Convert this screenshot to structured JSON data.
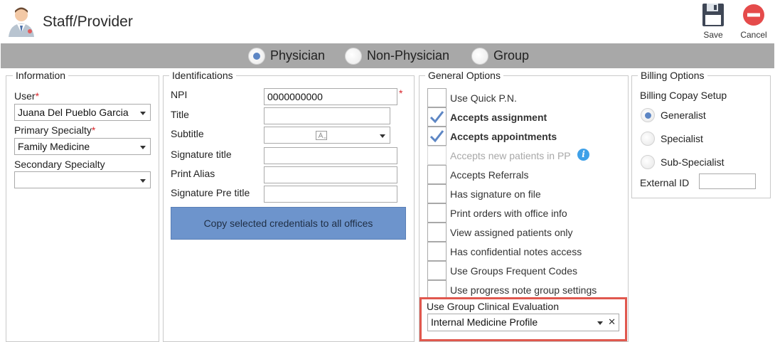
{
  "header": {
    "title": "Staff/Provider",
    "save_label": "Save",
    "cancel_label": "Cancel"
  },
  "tabs": [
    {
      "label": "Physician",
      "selected": true
    },
    {
      "label": "Non-Physician",
      "selected": false
    },
    {
      "label": "Group",
      "selected": false
    }
  ],
  "information": {
    "title": "Information",
    "user_label": "User",
    "user_value": "Juana Del Pueblo Garcia",
    "primary_specialty_label": "Primary Specialty",
    "primary_specialty_value": "Family Medicine",
    "secondary_specialty_label": "Secondary Specialty",
    "secondary_specialty_value": "",
    "required_mark": "*"
  },
  "identifications": {
    "title": "Identifications",
    "npi_label": "NPI",
    "npi_value": "0000000000",
    "title_label": "Title",
    "title_value": "",
    "subtitle_label": "Subtitle",
    "subtitle_value": "",
    "signature_title_label": "Signature title",
    "signature_title_value": "",
    "print_alias_label": "Print Alias",
    "print_alias_value": "",
    "signature_pre_title_label": "Signature Pre title",
    "signature_pre_title_value": "",
    "copy_button_label": "Copy selected credentials to all offices",
    "required_mark": "*"
  },
  "general_options": {
    "title": "General Options",
    "items": [
      {
        "label": "Use Quick P.N.",
        "checked": false,
        "bold": false,
        "disabled": false
      },
      {
        "label": "Accepts assignment",
        "checked": true,
        "bold": true,
        "disabled": false
      },
      {
        "label": "Accepts appointments",
        "checked": true,
        "bold": true,
        "disabled": false
      },
      {
        "label": "Accepts new patients in PP",
        "checked": false,
        "bold": false,
        "disabled": true
      },
      {
        "label": "Accepts Referrals",
        "checked": false,
        "bold": false,
        "disabled": false
      },
      {
        "label": "Has signature on file",
        "checked": false,
        "bold": false,
        "disabled": false
      },
      {
        "label": "Print orders with office info",
        "checked": false,
        "bold": false,
        "disabled": false
      },
      {
        "label": "View assigned patients only",
        "checked": false,
        "bold": false,
        "disabled": false
      },
      {
        "label": "Has confidential notes access",
        "checked": false,
        "bold": false,
        "disabled": false
      },
      {
        "label": "Use Groups Frequent Codes",
        "checked": false,
        "bold": false,
        "disabled": false
      },
      {
        "label": "Use progress note group settings",
        "checked": false,
        "bold": false,
        "disabled": false
      }
    ],
    "info_glyph": "i",
    "clinical_eval_label": "Use Group Clinical Evaluation",
    "clinical_eval_value": "Internal Medicine Profile",
    "clear_glyph": "✕"
  },
  "billing_options": {
    "title": "Billing Options",
    "copay_label": "Billing Copay Setup",
    "radios": [
      {
        "label": "Generalist",
        "selected": true
      },
      {
        "label": "Specialist",
        "selected": false
      },
      {
        "label": "Sub-Specialist",
        "selected": false
      }
    ],
    "external_id_label": "External ID",
    "external_id_value": ""
  },
  "colors": {
    "accent": "#5d86c4",
    "tabbar": "#a8a8a8",
    "button": "#6d94cc",
    "required": "#d9262c",
    "highlight": "#e0584e",
    "cancel": "#e54b4b"
  }
}
